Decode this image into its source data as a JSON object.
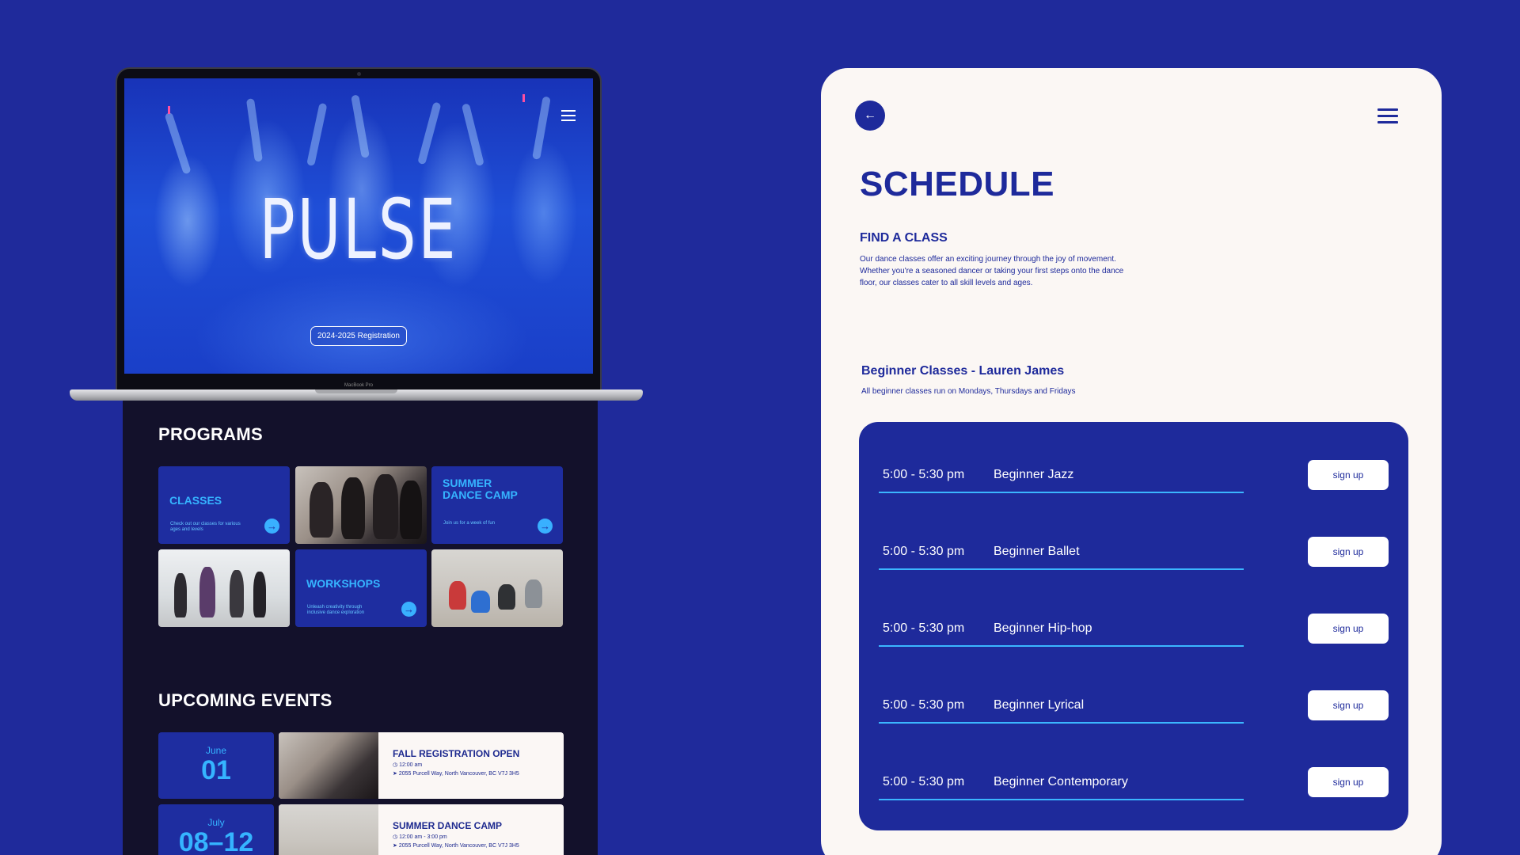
{
  "colors": {
    "background": "#1f2a9b",
    "brand_blue": "#1e2a9b",
    "accent_cyan": "#35b4ff",
    "panel_bg": "#fbf7f4",
    "dark_bg": "#13112b"
  },
  "laptop": {
    "logo": "PULSE",
    "registration_button": "2024-2025 Registration",
    "device_label": "MacBook Pro",
    "menu_icon": "hamburger-menu-icon"
  },
  "programs": {
    "title": "PROGRAMS",
    "tiles": [
      {
        "title": "CLASSES",
        "subtitle": "Check out our classes for various ages and levels",
        "icon": "arrow-right-icon"
      },
      {
        "title": "SUMMER DANCE CAMP",
        "subtitle": "Join us for a week of fun",
        "icon": "arrow-right-icon"
      },
      {
        "title": "WORKSHOPS",
        "subtitle": "Unleash creativity through inclusive dance exploration",
        "icon": "arrow-right-icon"
      }
    ]
  },
  "events": {
    "title": "UPCOMING EVENTS",
    "items": [
      {
        "month": "June",
        "day": "01",
        "title": "FALL REGISTRATION OPEN",
        "time": "12:00 am",
        "address": "2055 Purcell Way, North Vancouver, BC V7J 3H5"
      },
      {
        "month": "July",
        "day": "08–12",
        "title": "SUMMER DANCE CAMP",
        "time": "12:00 am - 3:00 pm",
        "address": "2055 Purcell Way, North Vancouver, BC V7J 3H5"
      }
    ]
  },
  "schedule": {
    "back_icon": "arrow-left-icon",
    "menu_icon": "hamburger-menu-icon",
    "title": "SCHEDULE",
    "find_title": "FIND A CLASS",
    "find_description": "Our dance classes offer an exciting journey through the joy of movement. Whether you're a seasoned dancer or taking your first steps onto the dance floor, our classes cater to all skill levels and ages.",
    "group_title": "Beginner Classes - Lauren James",
    "group_description": "All beginner classes run on Mondays, Thursdays and Fridays",
    "classes": [
      {
        "time": "5:00 - 5:30 pm",
        "name": "Beginner Jazz",
        "button": "sign up"
      },
      {
        "time": "5:00 - 5:30 pm",
        "name": "Beginner Ballet",
        "button": "sign up"
      },
      {
        "time": "5:00 - 5:30 pm",
        "name": "Beginner Hip-hop",
        "button": "sign up"
      },
      {
        "time": "5:00 - 5:30 pm",
        "name": "Beginner Lyrical",
        "button": "sign up"
      },
      {
        "time": "5:00 - 5:30 pm",
        "name": "Beginner Contemporary",
        "button": "sign up"
      }
    ]
  }
}
